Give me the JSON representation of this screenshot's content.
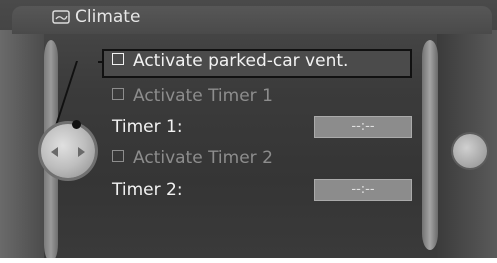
{
  "window": {
    "title": "Climate",
    "title_icon": "climate-icon"
  },
  "menu": {
    "items": [
      {
        "label": "Activate parked-car vent.",
        "checked": false,
        "enabled": true,
        "focused": true
      },
      {
        "label": "Activate Timer 1",
        "checked": false,
        "enabled": false
      },
      {
        "label": "Timer 1:",
        "value": "--:--",
        "enabled": true
      },
      {
        "label": "Activate Timer 2",
        "checked": false,
        "enabled": false
      },
      {
        "label": "Timer 2:",
        "value": "--:--",
        "enabled": true
      }
    ]
  },
  "colors": {
    "screen": "#3b3b3b",
    "focus_border": "#111111",
    "text": "#f2f2f2",
    "dim_text": "#8d8d8d"
  }
}
